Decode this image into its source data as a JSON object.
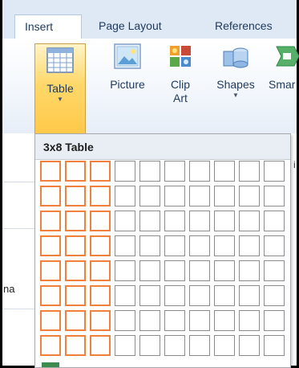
{
  "tabs": [
    {
      "label": "Insert",
      "active": true
    },
    {
      "label": "Page Layout",
      "active": false
    },
    {
      "label": "References",
      "active": false
    }
  ],
  "ribbon": {
    "buttons": [
      {
        "id": "table",
        "label": "Table",
        "has_arrow": true
      },
      {
        "id": "picture",
        "label": "Picture",
        "has_arrow": false
      },
      {
        "id": "clip_art",
        "label_line1": "Clip",
        "label_line2": "Art",
        "has_arrow": false
      },
      {
        "id": "shapes",
        "label": "Shapes",
        "has_arrow": true
      },
      {
        "id": "smartart",
        "label": "Smar",
        "has_arrow": false
      }
    ]
  },
  "dropdown": {
    "title": "3x8 Table",
    "grid": {
      "columns": 10,
      "rows": 8,
      "selected_columns": 3,
      "selected_rows": 8
    }
  },
  "background": {
    "partial_text_left": "na",
    "partial_text_right": "i"
  },
  "colors": {
    "selected_border": "#f0803c",
    "ribbon_hover": "#ffd86a",
    "tab_bar": "#dfe9f5"
  }
}
